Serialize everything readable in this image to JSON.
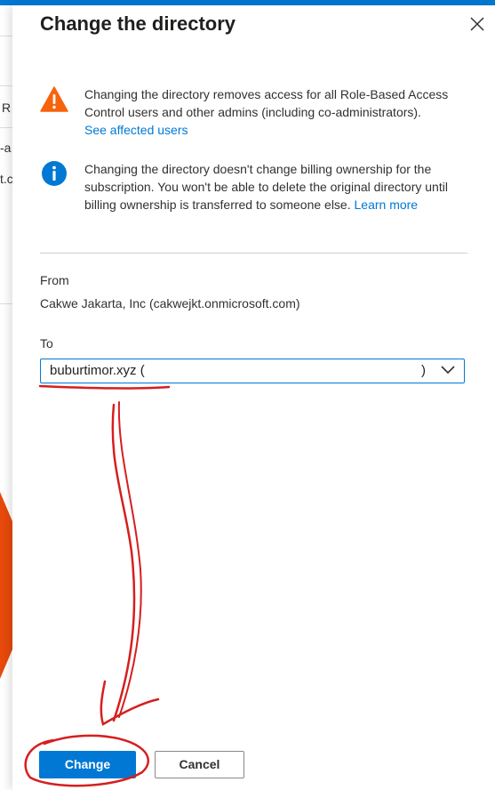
{
  "behind_page": {
    "fragments": [
      "R",
      "-a",
      "t.c"
    ]
  },
  "panel": {
    "title": "Change the directory",
    "close_icon": "close-icon"
  },
  "warning": {
    "icon": "warning-icon",
    "text": "Changing the directory removes access for all Role-Based Access Control users and other admins (including co-administrators).",
    "link": "See affected users"
  },
  "info": {
    "icon": "info-icon",
    "text": "Changing the directory doesn't change billing ownership for the subscription. You won't be able to delete the original directory until billing ownership is transferred to someone else.",
    "link": "Learn more"
  },
  "from": {
    "label": "From",
    "value": "Cakwe Jakarta, Inc (cakwejkt.onmicrosoft.com)"
  },
  "to": {
    "label": "To",
    "selected_value": "buburtimor.xyz (",
    "selected_value_end": ")",
    "chevron_icon": "chevron-down-icon"
  },
  "footer": {
    "change_label": "Change",
    "cancel_label": "Cancel"
  },
  "colors": {
    "accent": "#0078d4",
    "warning": "#f7630c",
    "annotation": "#d61f1f",
    "orange_shape": "#e84a0c"
  }
}
